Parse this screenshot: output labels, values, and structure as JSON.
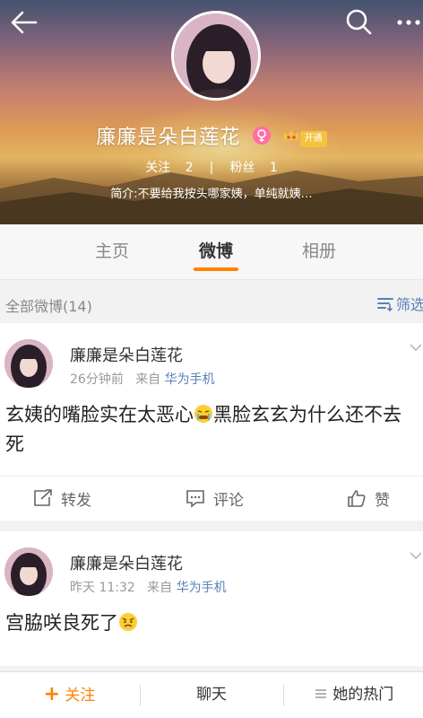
{
  "profile": {
    "name": "廉廉是朵白莲花",
    "vip_label": "开通",
    "following_label": "关注",
    "following_count": "2",
    "followers_label": "粉丝",
    "followers_count": "1",
    "stats_sep": "|",
    "bio": "简介:不要给我按头哪家姨，单纯就姨…"
  },
  "tabs": [
    {
      "label": "主页"
    },
    {
      "label": "微博"
    },
    {
      "label": "相册"
    }
  ],
  "filter": {
    "title": "全部微博(14)",
    "button_label": "筛选"
  },
  "posts": [
    {
      "author": "廉廉是朵白莲花",
      "time": "26分钟前",
      "from_label": "来自",
      "source": "华为手机",
      "text_part1": "玄姨的嘴脸实在太恶心",
      "text_part2": "黑脸玄玄为什么还不去死"
    },
    {
      "author": "廉廉是朵白莲花",
      "time": "昨天 11:32",
      "from_label": "来自",
      "source": "华为手机",
      "text_part1": "宫脇咲良死了"
    }
  ],
  "actions": {
    "repost": "转发",
    "comment": "评论",
    "like": "赞"
  },
  "bottom_bar": {
    "follow": "关注",
    "follow_plus": "+",
    "chat": "聊天",
    "hot": "她的热门"
  },
  "colors": {
    "accent": "#ff8200",
    "link": "#5b7fb5"
  }
}
